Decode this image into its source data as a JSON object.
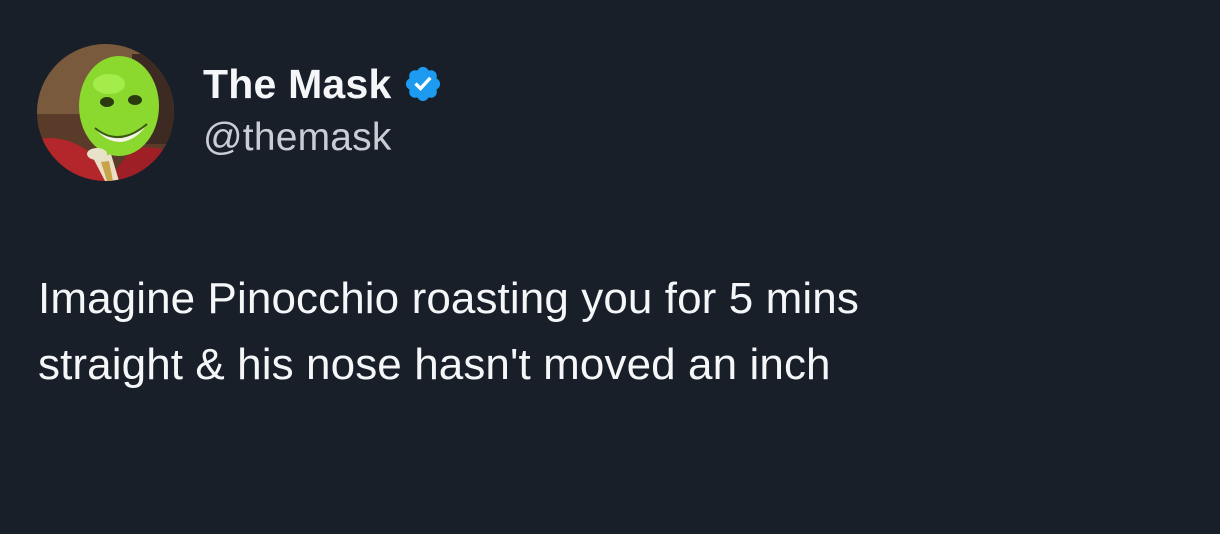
{
  "author": {
    "display_name": "The Mask",
    "handle": "@themask",
    "verified": true,
    "avatar_icon": "the-mask-avatar"
  },
  "tweet": {
    "text_lines": [
      "Imagine Pinocchio roasting you for 5 mins",
      "straight & his nose hasn't moved an inch"
    ]
  },
  "colors": {
    "background": "#181f29",
    "text": "#f4f6f8",
    "handle": "#c9ced4",
    "verified_badge": "#1d9bf0",
    "avatar_face": "#8bd82f"
  }
}
